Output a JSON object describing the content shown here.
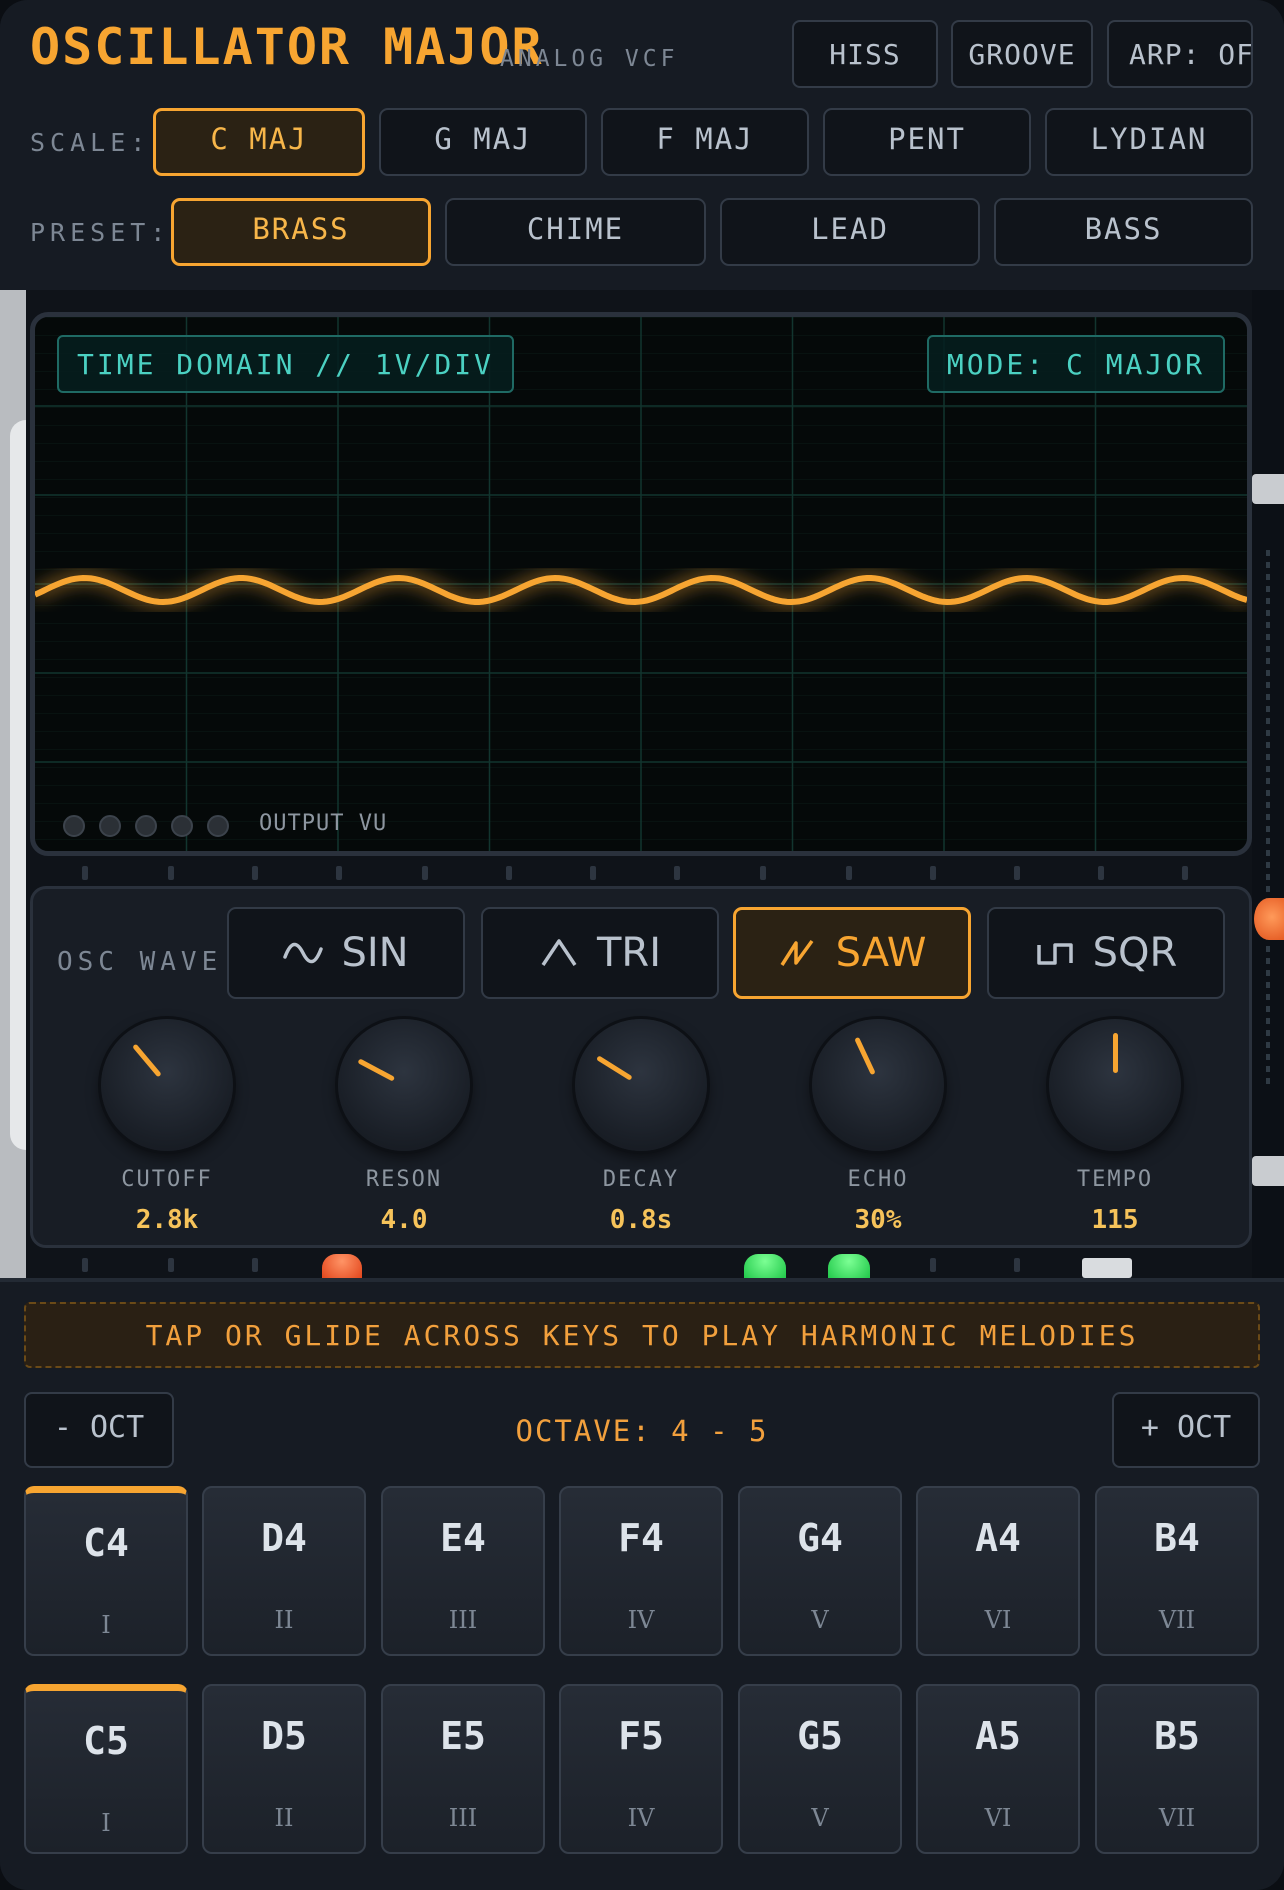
{
  "app": {
    "title": "OSCILLATOR MAJOR",
    "subtitle": "ANALOG VCF",
    "header_buttons": [
      "HISS",
      "GROOVE",
      "ARP: OFF"
    ]
  },
  "scale": {
    "label": "SCALE:",
    "options": [
      "C MAJ",
      "G MAJ",
      "F MAJ",
      "PENT",
      "LYDIAN"
    ],
    "selected": "C MAJ"
  },
  "preset": {
    "label": "PRESET:",
    "options": [
      "BRASS",
      "CHIME",
      "LEAD",
      "BASS"
    ],
    "selected": "BRASS"
  },
  "scope": {
    "tag_left": "TIME DOMAIN // 1V/DIV",
    "tag_right": "MODE: C MAJOR",
    "vu_label": "OUTPUT VU",
    "trace_color": "#f7a531",
    "grid_color": "#12352f"
  },
  "osc": {
    "label": "OSC WAVE:",
    "waves": [
      {
        "label": "SIN",
        "icon": "sine-wave-icon"
      },
      {
        "label": "TRI",
        "icon": "triangle-wave-icon"
      },
      {
        "label": "SAW",
        "icon": "saw-wave-icon"
      },
      {
        "label": "SQR",
        "icon": "square-wave-icon"
      }
    ],
    "selected": "SAW"
  },
  "knobs": [
    {
      "name": "CUTOFF",
      "value": "2.8k"
    },
    {
      "name": "RESON",
      "value": "4.0"
    },
    {
      "name": "DECAY",
      "value": "0.8s"
    },
    {
      "name": "ECHO",
      "value": "30%"
    },
    {
      "name": "TEMPO",
      "value": "115"
    }
  ],
  "keyboard": {
    "hint": "TAP OR GLIDE ACROSS KEYS TO PLAY HARMONIC MELODIES",
    "oct_down": "- OCT",
    "oct_up": "+ OCT",
    "octave_label": "OCTAVE: 4 - 5",
    "rows": [
      [
        {
          "note": "C4",
          "degree": "I"
        },
        {
          "note": "D4",
          "degree": "II"
        },
        {
          "note": "E4",
          "degree": "III"
        },
        {
          "note": "F4",
          "degree": "IV"
        },
        {
          "note": "G4",
          "degree": "V"
        },
        {
          "note": "A4",
          "degree": "VI"
        },
        {
          "note": "B4",
          "degree": "VII"
        }
      ],
      [
        {
          "note": "C5",
          "degree": "I"
        },
        {
          "note": "D5",
          "degree": "II"
        },
        {
          "note": "E5",
          "degree": "III"
        },
        {
          "note": "F5",
          "degree": "IV"
        },
        {
          "note": "G5",
          "degree": "V"
        },
        {
          "note": "A5",
          "degree": "VI"
        },
        {
          "note": "B5",
          "degree": "VII"
        }
      ]
    ]
  },
  "colors": {
    "accent": "#f7a531",
    "teal": "#4bd1c2",
    "led_red": "#ff5b2e",
    "led_green": "#2fe05a"
  }
}
